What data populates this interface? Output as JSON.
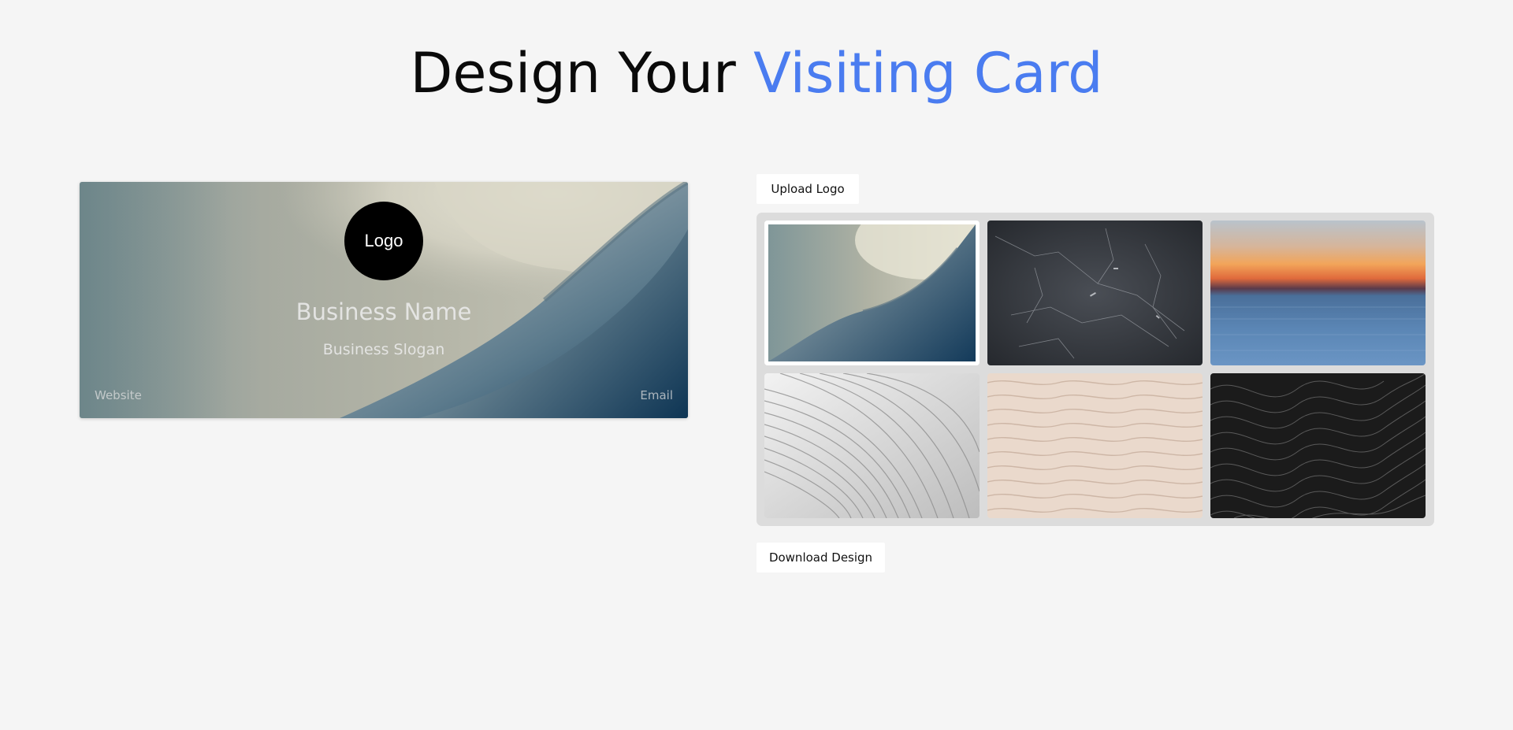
{
  "heading": {
    "prefix": "Design Your",
    "accent": "Visiting Card",
    "accent_color": "#4a7cf0"
  },
  "card": {
    "logo_label": "Logo",
    "business_name": "Business Name",
    "business_slogan": "Business Slogan",
    "website_label": "Website",
    "email_label": "Email",
    "background": "abstract-architecture-teal"
  },
  "controls": {
    "upload_label": "Upload Logo",
    "download_label": "Download Design"
  },
  "gallery": {
    "selected_index": 0,
    "backgrounds": [
      {
        "name": "abstract-architecture-teal"
      },
      {
        "name": "black-marble"
      },
      {
        "name": "sunset-sea"
      },
      {
        "name": "white-curved-structure"
      },
      {
        "name": "beige-wave-texture"
      },
      {
        "name": "dark-wave-lines"
      }
    ]
  }
}
